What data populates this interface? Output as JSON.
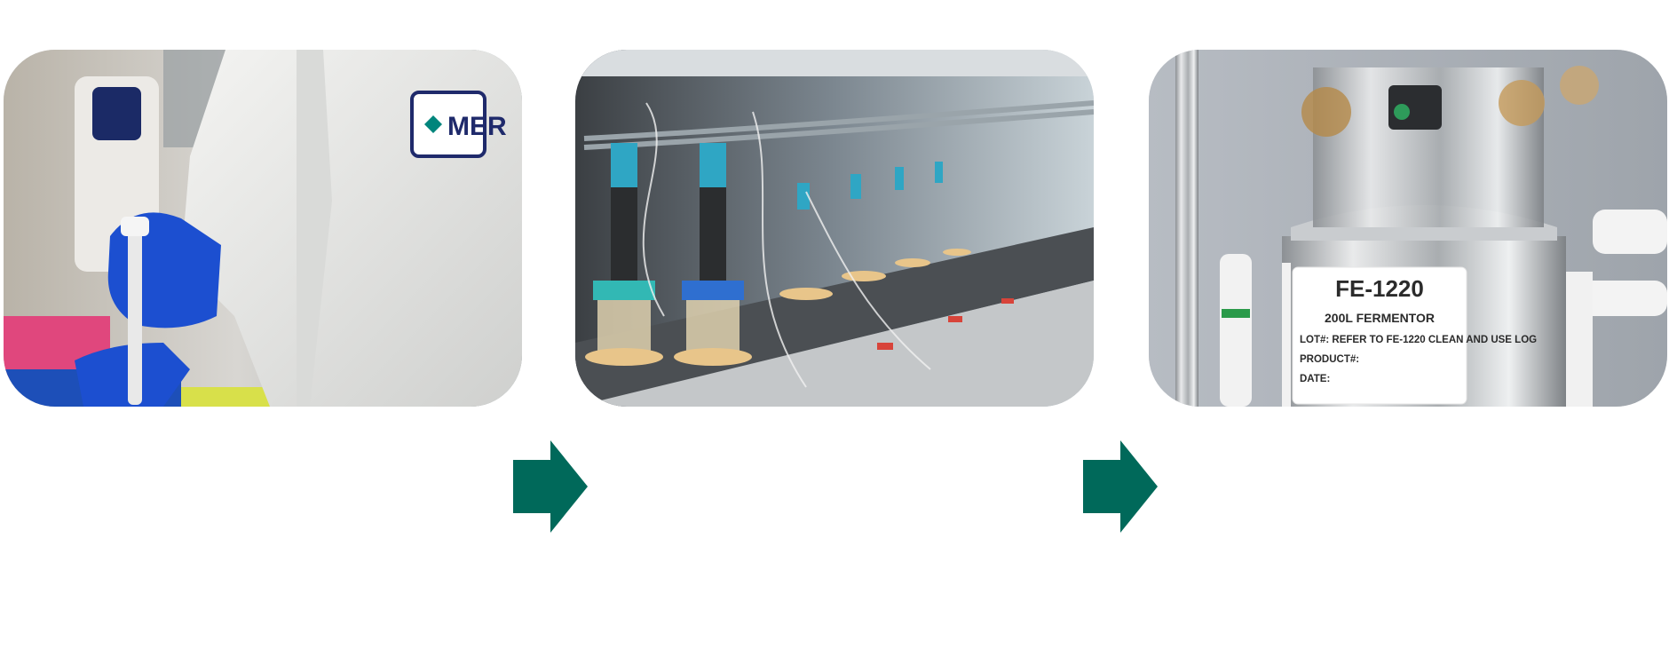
{
  "accent_color": "#00695a",
  "panels": [
    {
      "name": "lab-scientist-photo",
      "logo_text": "MER"
    },
    {
      "name": "bioreactor-array-photo"
    },
    {
      "name": "fermentor-vessel-photo",
      "label": {
        "id": "FE-1220",
        "capacity": "200L FERMENTOR",
        "lot": "LOT#: REFER TO FE-1220 CLEAN AND USE LOG",
        "product": "PRODUCT#:",
        "date": "DATE:"
      }
    }
  ],
  "arrows": [
    {
      "name": "arrow-right-icon"
    },
    {
      "name": "arrow-right-icon"
    }
  ]
}
